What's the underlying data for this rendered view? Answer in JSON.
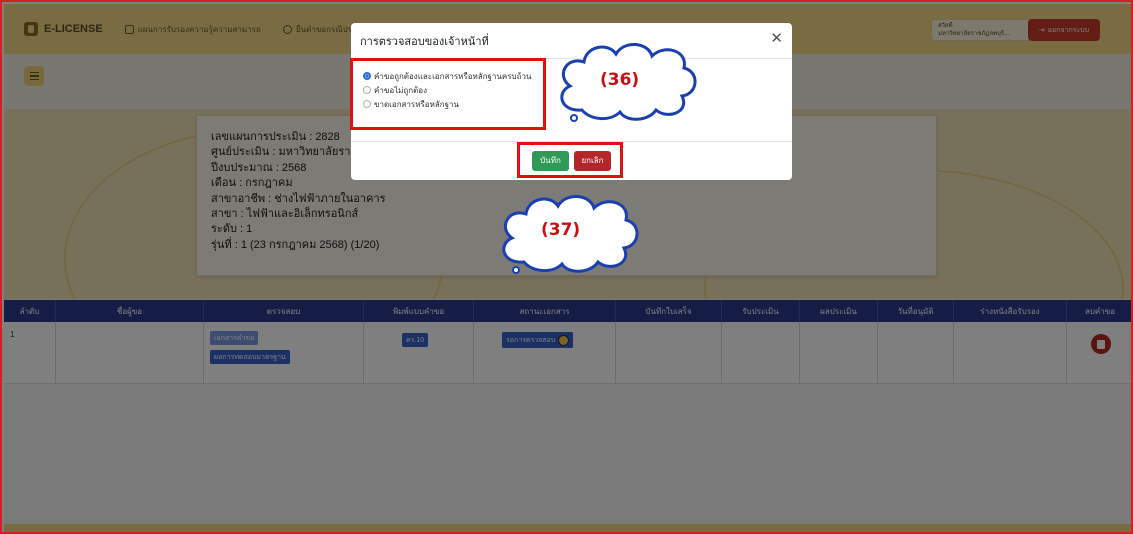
{
  "colors": {
    "nav_bg": "#f4d884",
    "table_header_bg": "#2b3a8f",
    "primary_pill": "#3760c8",
    "save_button": "#2f9a58",
    "cancel_button": "#b4262a",
    "logout_button": "#c93a2a",
    "annotation_red": "#e21010",
    "radio_checked": "#2f6fd6"
  },
  "topnav": {
    "logo_text": "E-LICENSE",
    "logo_icon": "license-logo-icon",
    "links": [
      {
        "label": "แผนการรับรองความรู้ความสามารถ",
        "icon": "calendar-icon"
      },
      {
        "label": "ยื่นคำขอกรณีประชาชน Wa",
        "icon": "user-add-icon"
      }
    ],
    "user_name": "สวัสดี",
    "user_org": "มหาวิทยาลัยราชภัฏลพบุรี...",
    "logout_label": "ออกจากระบบ",
    "logout_icon": "logout-icon"
  },
  "info": {
    "lines": [
      "เลขแผนการประเมิน : 2828",
      "ศูนย์ประเมิน : มหาวิทยาลัยราช",
      "ปีงบประมาณ : 2568",
      "เดือน : กรกฎาคม",
      "สาขาอาชีพ : ช่างไฟฟ้าภายในอาคาร",
      "สาขา : ไฟฟ้าและอิเล็กทรอนิกส์",
      "ระดับ : 1",
      "รุ่นที่ : 1 (23 กรกฎาคม 2568) (1/20)"
    ]
  },
  "table": {
    "headers": [
      "ลำดับ",
      "ชื่อผู้ขอ",
      "ตรวจสอบ",
      "พิมพ์แบบคำขอ",
      "สถานะเอกสาร",
      "บันทึกใบเสร็จ",
      "รับประเมิน",
      "ผลประเมิน",
      "วันที่อนุมัติ",
      "ร่างหนังสือรับรอง",
      "ลบคำขอ"
    ],
    "rows": [
      {
        "no": "1",
        "check_buttons": [
          "เอกสารคำขอ",
          "ผลการทดสอบมาตรฐาน"
        ],
        "print_button": "คร.10",
        "status": "รอการตรวจสอบ"
      }
    ]
  },
  "modal": {
    "title": "การตรวจสอบของเจ้าหน้าที่",
    "close_icon": "close-icon",
    "options": [
      {
        "label": "คำขอถูกต้องและเอกสารหรือหลักฐานครบถ้วน",
        "checked": true
      },
      {
        "label": "คำขอไม่ถูกต้อง",
        "checked": false
      },
      {
        "label": "ขาดเอกสารหรือหลักฐาน",
        "checked": false
      }
    ],
    "save_label": "บันทึก",
    "cancel_label": "ยกเลิก"
  },
  "annotations": {
    "callout_1": "(36)",
    "callout_2": "(37)"
  }
}
